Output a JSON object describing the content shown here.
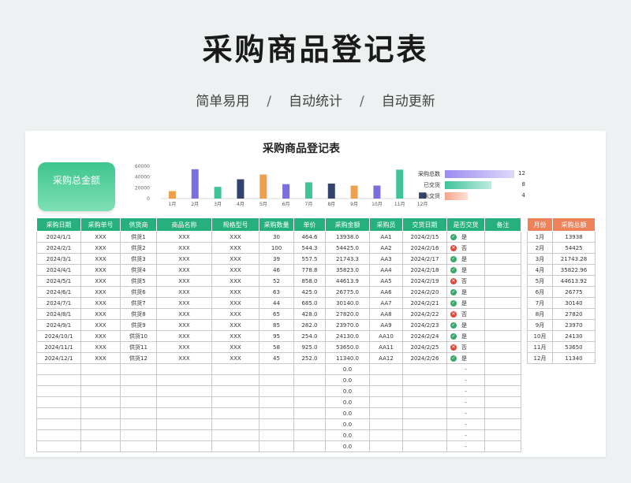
{
  "header": {
    "title": "采购商品登记表",
    "subtitle_items": [
      "简单易用",
      "自动统计",
      "自动更新"
    ],
    "separator": "/"
  },
  "sheet": {
    "title": "采购商品登记表",
    "total_box_label": "采购总金额"
  },
  "chart_data": {
    "type": "bar",
    "categories": [
      "1月",
      "2月",
      "3月",
      "4月",
      "5月",
      "6月",
      "7月",
      "8月",
      "9月",
      "10月",
      "11月",
      "12月"
    ],
    "values": [
      13938,
      54425,
      21743.28,
      35823.96,
      44613.92,
      26775,
      30140,
      27820,
      23970,
      24130,
      53650,
      11340
    ],
    "bar_colors": [
      "#f0a04b",
      "#7b6fe0",
      "#3fc49a",
      "#34426e",
      "#f0a04b",
      "#7b6fe0",
      "#3fc49a",
      "#34426e",
      "#f0a04b",
      "#7b6fe0",
      "#3fc49a",
      "#34426e"
    ],
    "yticks": [
      "0",
      "20000",
      "40000",
      "60000"
    ],
    "ylim": [
      0,
      60000
    ]
  },
  "summary_bars": [
    {
      "label": "采购总数",
      "value": "12",
      "fraction": 1.0,
      "color": "#9b8cf0"
    },
    {
      "label": "已交货",
      "value": "8",
      "fraction": 0.667,
      "color": "#3fc49a"
    },
    {
      "label": "未交货",
      "value": "4",
      "fraction": 0.333,
      "color": "#f5a58a"
    }
  ],
  "table": {
    "headers": [
      "采购日期",
      "采购单号",
      "供货商",
      "商品名称",
      "规格型号",
      "采购数量",
      "单价",
      "采购金额",
      "采购员",
      "交货日期",
      "是否交货",
      "备注"
    ],
    "rows": [
      {
        "date": "2024/1/1",
        "order": "XXX",
        "supplier": "供货1",
        "product": "XXX",
        "spec": "XXX",
        "qty": "30",
        "price": "464.6",
        "amount": "13938.0",
        "buyer": "AA1",
        "delivery": "2024/2/15",
        "delivered": true,
        "status_text": "是"
      },
      {
        "date": "2024/2/1",
        "order": "XXX",
        "supplier": "供货2",
        "product": "XXX",
        "spec": "XXX",
        "qty": "100",
        "price": "544.3",
        "amount": "54425.0",
        "buyer": "AA2",
        "delivery": "2024/2/16",
        "delivered": false,
        "status_text": "否"
      },
      {
        "date": "2024/3/1",
        "order": "XXX",
        "supplier": "供货3",
        "product": "XXX",
        "spec": "XXX",
        "qty": "39",
        "price": "557.5",
        "amount": "21743.3",
        "buyer": "AA3",
        "delivery": "2024/2/17",
        "delivered": true,
        "status_text": "是"
      },
      {
        "date": "2024/4/1",
        "order": "XXX",
        "supplier": "供货4",
        "product": "XXX",
        "spec": "XXX",
        "qty": "46",
        "price": "778.8",
        "amount": "35823.0",
        "buyer": "AA4",
        "delivery": "2024/2/18",
        "delivered": true,
        "status_text": "是"
      },
      {
        "date": "2024/5/1",
        "order": "XXX",
        "supplier": "供货5",
        "product": "XXX",
        "spec": "XXX",
        "qty": "52",
        "price": "858.0",
        "amount": "44613.9",
        "buyer": "AA5",
        "delivery": "2024/2/19",
        "delivered": false,
        "status_text": "否"
      },
      {
        "date": "2024/6/1",
        "order": "XXX",
        "supplier": "供货6",
        "product": "XXX",
        "spec": "XXX",
        "qty": "63",
        "price": "425.0",
        "amount": "26775.0",
        "buyer": "AA6",
        "delivery": "2024/2/20",
        "delivered": true,
        "status_text": "是"
      },
      {
        "date": "2024/7/1",
        "order": "XXX",
        "supplier": "供货7",
        "product": "XXX",
        "spec": "XXX",
        "qty": "44",
        "price": "685.0",
        "amount": "30140.0",
        "buyer": "AA7",
        "delivery": "2024/2/21",
        "delivered": true,
        "status_text": "是"
      },
      {
        "date": "2024/8/1",
        "order": "XXX",
        "supplier": "供货8",
        "product": "XXX",
        "spec": "XXX",
        "qty": "65",
        "price": "428.0",
        "amount": "27820.0",
        "buyer": "AA8",
        "delivery": "2024/2/22",
        "delivered": false,
        "status_text": "否"
      },
      {
        "date": "2024/9/1",
        "order": "XXX",
        "supplier": "供货9",
        "product": "XXX",
        "spec": "XXX",
        "qty": "85",
        "price": "282.0",
        "amount": "23970.0",
        "buyer": "AA9",
        "delivery": "2024/2/23",
        "delivered": true,
        "status_text": "是"
      },
      {
        "date": "2024/10/1",
        "order": "XXX",
        "supplier": "供货10",
        "product": "XXX",
        "spec": "XXX",
        "qty": "95",
        "price": "254.0",
        "amount": "24130.0",
        "buyer": "AA10",
        "delivery": "2024/2/24",
        "delivered": true,
        "status_text": "是"
      },
      {
        "date": "2024/11/1",
        "order": "XXX",
        "supplier": "供货11",
        "product": "XXX",
        "spec": "XXX",
        "qty": "58",
        "price": "925.0",
        "amount": "53650.0",
        "buyer": "AA11",
        "delivery": "2024/2/25",
        "delivered": false,
        "status_text": "否"
      },
      {
        "date": "2024/12/1",
        "order": "XXX",
        "supplier": "供货12",
        "product": "XXX",
        "spec": "XXX",
        "qty": "45",
        "price": "252.0",
        "amount": "11340.0",
        "buyer": "AA12",
        "delivery": "2024/2/26",
        "delivered": true,
        "status_text": "是"
      }
    ],
    "empty_row_amount": "0.0",
    "empty_row_status": "-",
    "empty_row_count": 8
  },
  "monthly": {
    "headers": [
      "月份",
      "采购总额"
    ],
    "rows": [
      {
        "month": "1月",
        "total": "13938"
      },
      {
        "month": "2月",
        "total": "54425"
      },
      {
        "month": "3月",
        "total": "21743.28"
      },
      {
        "month": "4月",
        "total": "35822.96"
      },
      {
        "month": "5月",
        "total": "44613.92"
      },
      {
        "month": "6月",
        "total": "26775"
      },
      {
        "month": "7月",
        "total": "30140"
      },
      {
        "month": "8月",
        "total": "27820"
      },
      {
        "month": "9月",
        "total": "23970"
      },
      {
        "month": "10月",
        "total": "24130"
      },
      {
        "month": "11月",
        "total": "53650"
      },
      {
        "month": "12月",
        "total": "11340"
      }
    ]
  }
}
